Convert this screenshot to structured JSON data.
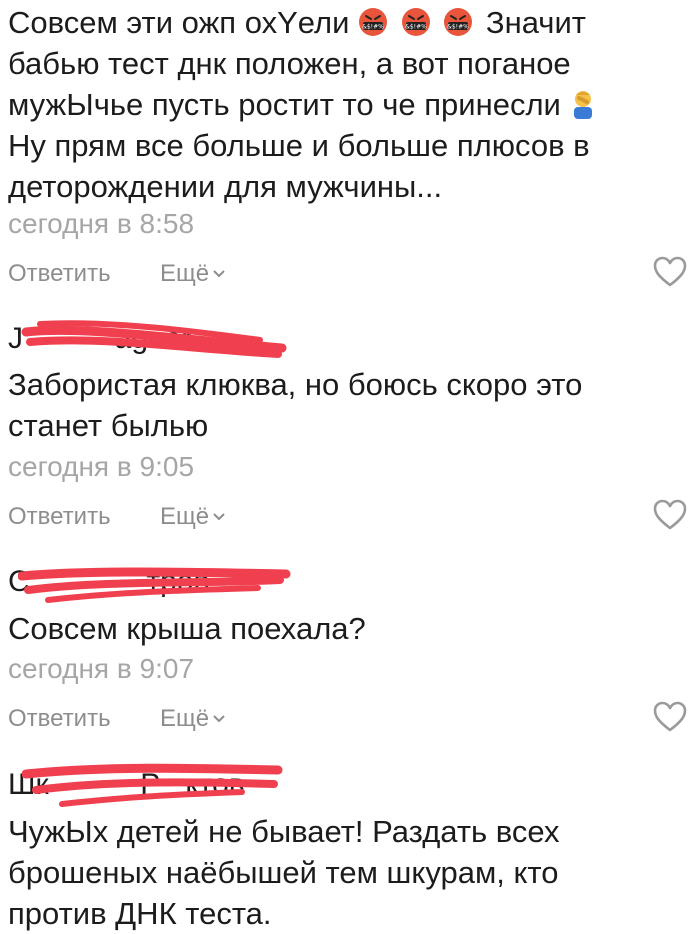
{
  "comments": [
    {
      "author": "",
      "text_lines": [
        "Совсем эти ожп охYели",
        "бабью тест днк положен, а вот поганое",
        "мужЫчье пусть ростит то че принесли",
        "Ну прям все больше и больше плюсов в",
        "деторождении для мужчины..."
      ],
      "text_after_emojis": "Значит",
      "emojis": [
        "cursing-face-icon",
        "cursing-face-icon",
        "cursing-face-icon"
      ],
      "end_emoji": "person-facepalming-icon",
      "time": "сегодня в 8:58",
      "reply_label": "Ответить",
      "more_label": "Ещё"
    },
    {
      "author_visible": "J           agner",
      "text_lines": [
        "Забористая клюква, но боюсь скоро это",
        "станет былью"
      ],
      "time": "сегодня в 9:05",
      "reply_label": "Ответить",
      "more_label": "Ещё"
    },
    {
      "author_visible": "С              тров",
      "text_lines": [
        "Совсем крыша поехала?"
      ],
      "time": "сегодня в 9:07",
      "reply_label": "Ответить",
      "more_label": "Ещё"
    },
    {
      "author_visible": "Шк           Р   ктов",
      "text_lines": [
        "ЧужЫх детей не бывает! Раздать всех",
        "брошеных наёбышей тем шкурам, кто",
        "против ДНК теста."
      ]
    }
  ],
  "colors": {
    "text": "#1c1c1c",
    "meta": "#a6a6a6",
    "action": "#8d8d8d",
    "redaction": "#f0404f",
    "emoji_face": "#e8553b"
  }
}
